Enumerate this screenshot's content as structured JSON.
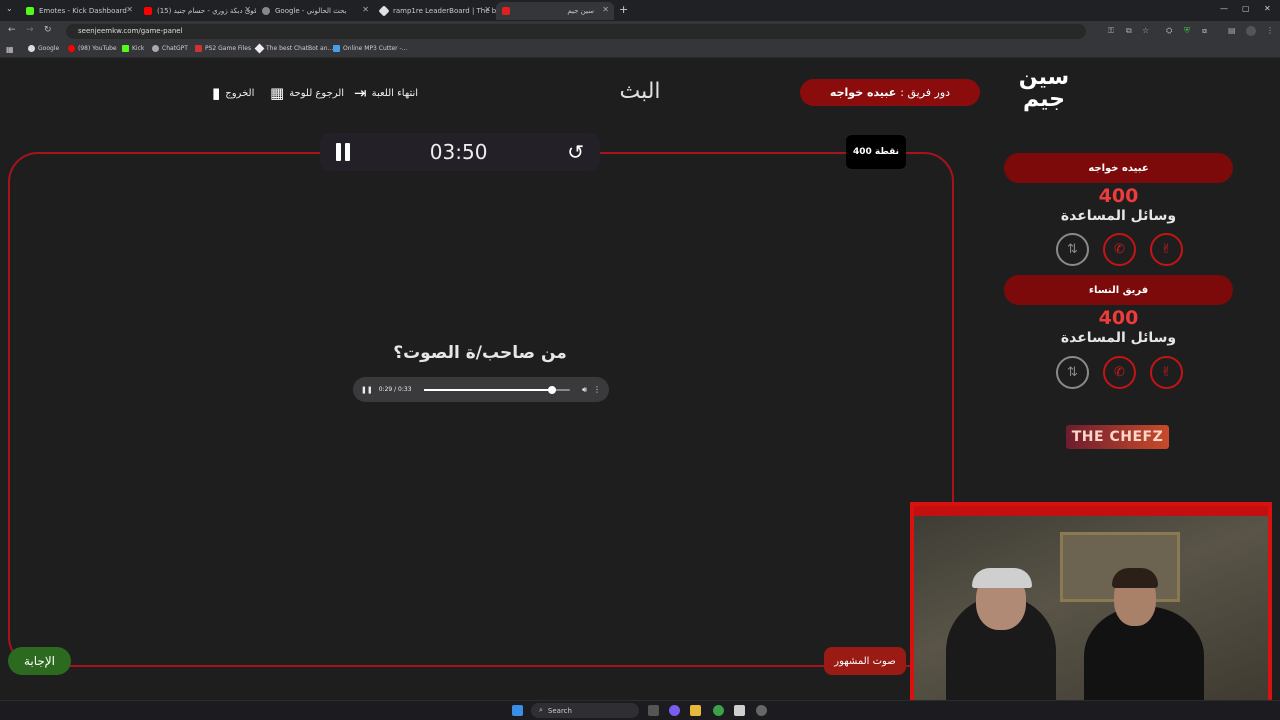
{
  "browser": {
    "tabs": [
      {
        "title": "Emotes - Kick Dashboard",
        "color": "#53fc18"
      },
      {
        "title": "(15) أقوى دبكة زوري - حسام جنيد",
        "color": "#ff0000"
      },
      {
        "title": "Google - بحث الحالوني",
        "color": "#999999"
      },
      {
        "title": "ramp1re LeaderBoard | The bi",
        "color": "#e0e0e0"
      },
      {
        "title": "سين جيم",
        "color": "#e02020"
      }
    ],
    "url": "seenjeemkw.com/game-panel",
    "bookmarks": [
      "Google",
      "(98) YouTube",
      "Kick",
      "ChatGPT",
      "PS2 Game Files",
      "The best ChatBot an...",
      "Online MP3 Cutter -..."
    ]
  },
  "header": {
    "logo": "سين جيم",
    "turn_label": "دور فريق :",
    "turn_team": "عبيده خواجه",
    "title": "البث",
    "end_game": "انتهاء اللعبة",
    "back_to_board": "الرجوع للوحة",
    "exit": "الخروج"
  },
  "timer": {
    "time": "03:50"
  },
  "points_badge": "400 نقطة",
  "question": {
    "text": "من صاحب/ة الصوت؟",
    "audio_time": "0:29 / 0:33",
    "audio_progress": 0.88
  },
  "buttons": {
    "answer": "الإجابة",
    "category": "صوت المشهور"
  },
  "teams": [
    {
      "name": "عبيده خواجه",
      "score": "400",
      "helpers_label": "وسائل المساعدة"
    },
    {
      "name": "فريق النساء",
      "score": "400",
      "helpers_label": "وسائل المساعدة"
    }
  ],
  "sponsor": {
    "the": "THE",
    "name": "CHEFZ"
  },
  "taskbar": {
    "search": "Search"
  }
}
